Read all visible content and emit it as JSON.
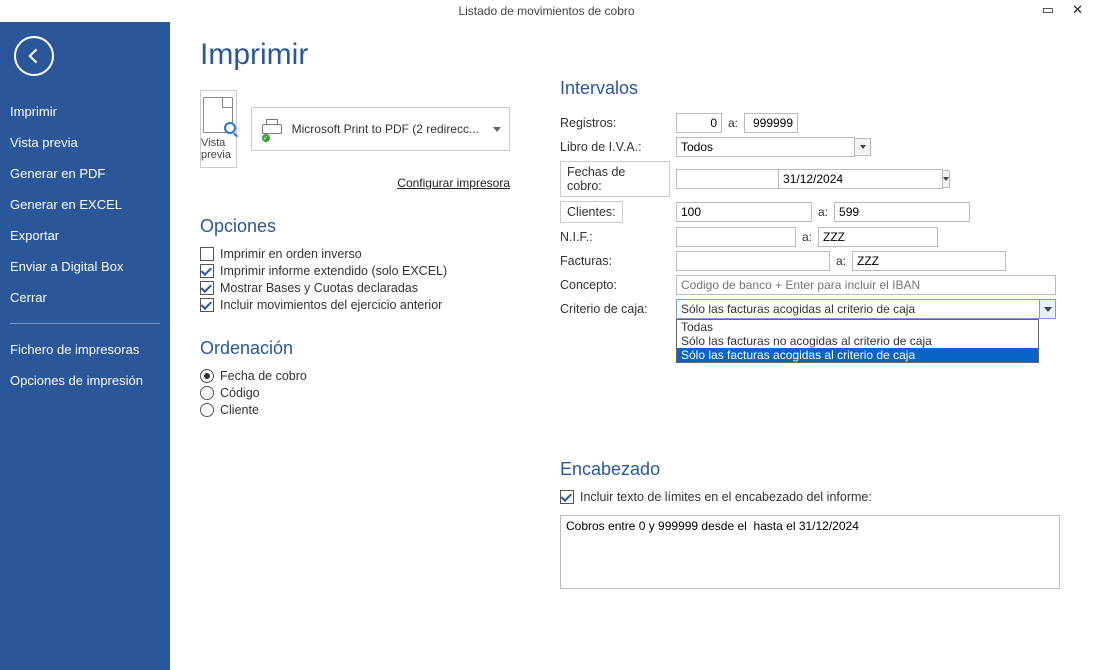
{
  "window": {
    "title": "Listado de movimientos de cobro"
  },
  "sidebar": {
    "items": [
      "Imprimir",
      "Vista previa",
      "Generar en PDF",
      "Generar en EXCEL",
      "Exportar",
      "Enviar a Digital Box",
      "Cerrar"
    ],
    "items2": [
      "Fichero de impresoras",
      "Opciones de impresión"
    ]
  },
  "page": {
    "title": "Imprimir",
    "preview_label": "Vista previa",
    "printer_label": "Microsoft Print to PDF (2 redirecc...",
    "config_link": "Configurar impresora"
  },
  "opciones": {
    "title": "Opciones",
    "items": [
      {
        "label": "Imprimir en orden inverso",
        "checked": false
      },
      {
        "label": "Imprimir informe extendido (solo EXCEL)",
        "checked": true
      },
      {
        "label": "Mostrar Bases y Cuotas declaradas",
        "checked": true
      },
      {
        "label": "Incluir movimientos del ejercicio anterior",
        "checked": true
      }
    ]
  },
  "ordenacion": {
    "title": "Ordenación",
    "items": [
      {
        "label": "Fecha de cobro",
        "selected": true
      },
      {
        "label": "Código",
        "selected": false
      },
      {
        "label": "Cliente",
        "selected": false
      }
    ]
  },
  "intervalos": {
    "title": "Intervalos",
    "registros_label": "Registros:",
    "registros_from": "0",
    "registros_to": "999999",
    "a_label": "a:",
    "libro_iva_label": "Libro de I.V.A.:",
    "libro_iva_value": "Todos",
    "fechas_label": "Fechas de cobro:",
    "fechas_from": "",
    "fechas_to": "31/12/2024",
    "clientes_label": "Clientes:",
    "clientes_from": "100",
    "clientes_to": "599",
    "nif_label": "N.I.F.:",
    "nif_from": "",
    "nif_to": "ZZZ",
    "facturas_label": "Facturas:",
    "facturas_from": "",
    "facturas_to": "ZZZ",
    "concepto_label": "Concepto:",
    "concepto_placeholder": "Codigo de banco + Enter para incluir el IBAN",
    "criterio_label": "Criterio de caja:",
    "criterio_value": "Sólo las facturas acogidas al criterio de caja",
    "criterio_options": [
      "Todas",
      "Sólo las facturas no acogidas al criterio de caja",
      "Sólo las facturas acogidas al criterio de caja"
    ]
  },
  "encabezado": {
    "title": "Encabezado",
    "include_label": "Incluir texto de límites en el encabezado del informe:",
    "include_checked": true,
    "text": "Cobros entre 0 y 999999 desde el  hasta el 31/12/2024"
  }
}
